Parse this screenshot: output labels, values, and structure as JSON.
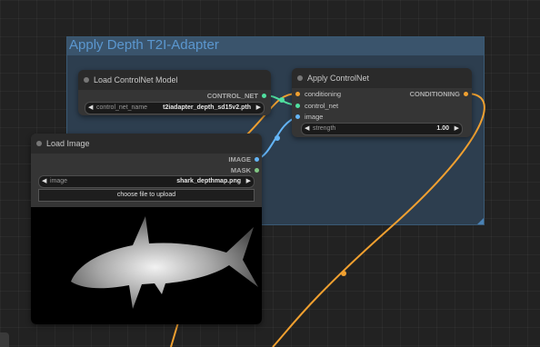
{
  "group": {
    "title": "Apply Depth T2I-Adapter"
  },
  "load_controlnet": {
    "title": "Load ControlNet Model",
    "output_label": "CONTROL_NET",
    "widget_label": "control_net_name",
    "widget_value": "t2iadapter_depth_sd15v2.pth"
  },
  "apply_controlnet": {
    "title": "Apply ControlNet",
    "inputs": [
      "conditioning",
      "control_net",
      "image"
    ],
    "output_label": "CONDITIONING",
    "strength_label": "strength",
    "strength_value": "1.00"
  },
  "load_image": {
    "title": "Load Image",
    "outputs": [
      "IMAGE",
      "MASK"
    ],
    "widget_label": "image",
    "widget_value": "shark_depthmap.png",
    "upload_label": "choose file to upload"
  },
  "colors": {
    "conditioning": "#f0a030",
    "control_net": "#50e0a0",
    "image": "#64b5f6",
    "mask": "#81c784"
  },
  "icons": {
    "left_arrow": "◀",
    "right_arrow": "▶"
  }
}
